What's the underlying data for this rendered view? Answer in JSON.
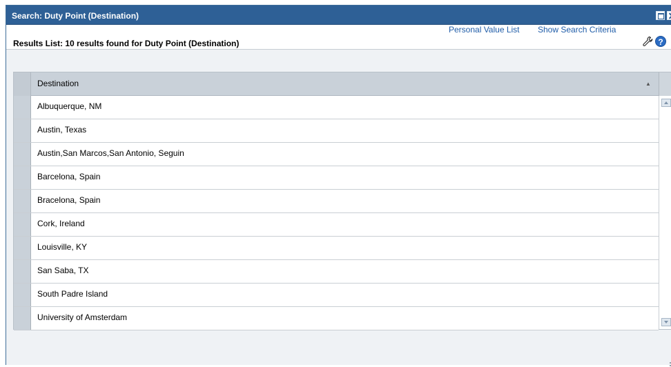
{
  "window": {
    "title": "Search: Duty Point (Destination)",
    "buttons": {
      "maximize_icon": "maximize-icon",
      "close_icon": "close-icon"
    }
  },
  "results": {
    "heading": "Results List: 10 results found for Duty Point (Destination)",
    "links": {
      "personal_value_list": "Personal Value List",
      "show_search_criteria": "Show Search Criteria"
    },
    "icons": {
      "settings": "wrench-icon",
      "help": "help-icon"
    },
    "help_glyph": "?"
  },
  "table": {
    "column": "Destination",
    "sort_glyph": "▲",
    "rows": [
      "Albuquerque, NM",
      "Austin, Texas",
      "Austin,San Marcos,San Antonio, Seguin",
      "Barcelona, Spain",
      "Bracelona, Spain",
      "Cork, Ireland",
      "Louisville, KY",
      "San Saba, TX",
      "South Padre Island",
      "University of Amsterdam"
    ]
  },
  "colors": {
    "titlebar": "#2e6096",
    "link": "#1f5ca8",
    "header": "#c9d1d9"
  }
}
